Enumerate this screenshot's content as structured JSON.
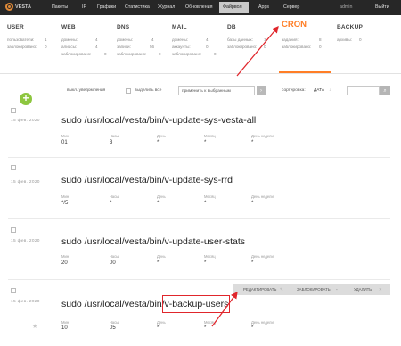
{
  "topbar": {
    "logo": "VESTA",
    "menu": [
      "Пакеты",
      "IP",
      "Графики",
      "Статистика",
      "Журнал",
      "Обновления",
      "Файрвол",
      "Apps",
      "Сервер"
    ],
    "active_menu": "Cron",
    "user": "admin",
    "logout": "Выйти"
  },
  "stats": {
    "user": {
      "title": "USER",
      "rows": [
        [
          "пользователи:",
          "1"
        ],
        [
          "заблокировано:",
          "0"
        ]
      ]
    },
    "web": {
      "title": "WEB",
      "rows": [
        [
          "домены:",
          "4"
        ],
        [
          "алиасы:",
          "4"
        ],
        [
          "заблокировано:",
          "0"
        ]
      ]
    },
    "dns": {
      "title": "DNS",
      "rows": [
        [
          "домены:",
          "4"
        ],
        [
          "записи:",
          "56"
        ],
        [
          "заблокировано:",
          "0"
        ]
      ]
    },
    "mail": {
      "title": "MAIL",
      "rows": [
        [
          "домены:",
          "4"
        ],
        [
          "аккаунты:",
          "0"
        ],
        [
          "заблокировано:",
          "0"
        ]
      ]
    },
    "db": {
      "title": "DB",
      "rows": [
        [
          "базы данных:",
          "1"
        ],
        [
          "заблокировано:",
          "0"
        ]
      ]
    },
    "cron": {
      "title": "CRON",
      "rows": [
        [
          "задания:",
          "8"
        ],
        [
          "заблокировано:",
          "0"
        ]
      ]
    },
    "backup": {
      "title": "BACKUP",
      "rows": [
        [
          "архивы:",
          "0"
        ]
      ]
    }
  },
  "toolbar": {
    "notifications": "выкл. уведомления",
    "select_all": "выделить все",
    "bulk_action": "применить к выбранным",
    "sort_label": "сортировка:",
    "sort_value": "ДАТА",
    "sort_arrow": "↓"
  },
  "columns": {
    "min": "Мин",
    "hour": "Часы",
    "day": "День",
    "month": "Месяц",
    "weekday": "День недели"
  },
  "jobs": [
    {
      "date": "15 фев. 2020",
      "cmd": "sudo /usr/local/vesta/bin/v-update-sys-vesta-all",
      "min": "01",
      "hour": "3",
      "day": "*",
      "month": "*",
      "weekday": "*"
    },
    {
      "date": "15 фев. 2020",
      "cmd": "sudo /usr/local/vesta/bin/v-update-sys-rrd",
      "min": "*/5",
      "hour": "*",
      "day": "*",
      "month": "*",
      "weekday": "*"
    },
    {
      "date": "15 фев. 2020",
      "cmd": "sudo /usr/local/vesta/bin/v-update-user-stats",
      "min": "20",
      "hour": "00",
      "day": "*",
      "month": "*",
      "weekday": "*"
    },
    {
      "date": "15 фев. 2020",
      "cmd": "sudo /usr/local/vesta/bin/v-backup-users",
      "min": "10",
      "hour": "05",
      "day": "*",
      "month": "*",
      "weekday": "*"
    }
  ],
  "actions": {
    "edit": "РЕДАКТИРОВАТЬ",
    "suspend": "ЗАБЛОКИРОВАТЬ",
    "delete": "УДАЛИТЬ",
    "close": "✕"
  },
  "colors": {
    "accent": "#ff7e26",
    "add": "#8dc63f",
    "highlight": "#e0262c"
  }
}
